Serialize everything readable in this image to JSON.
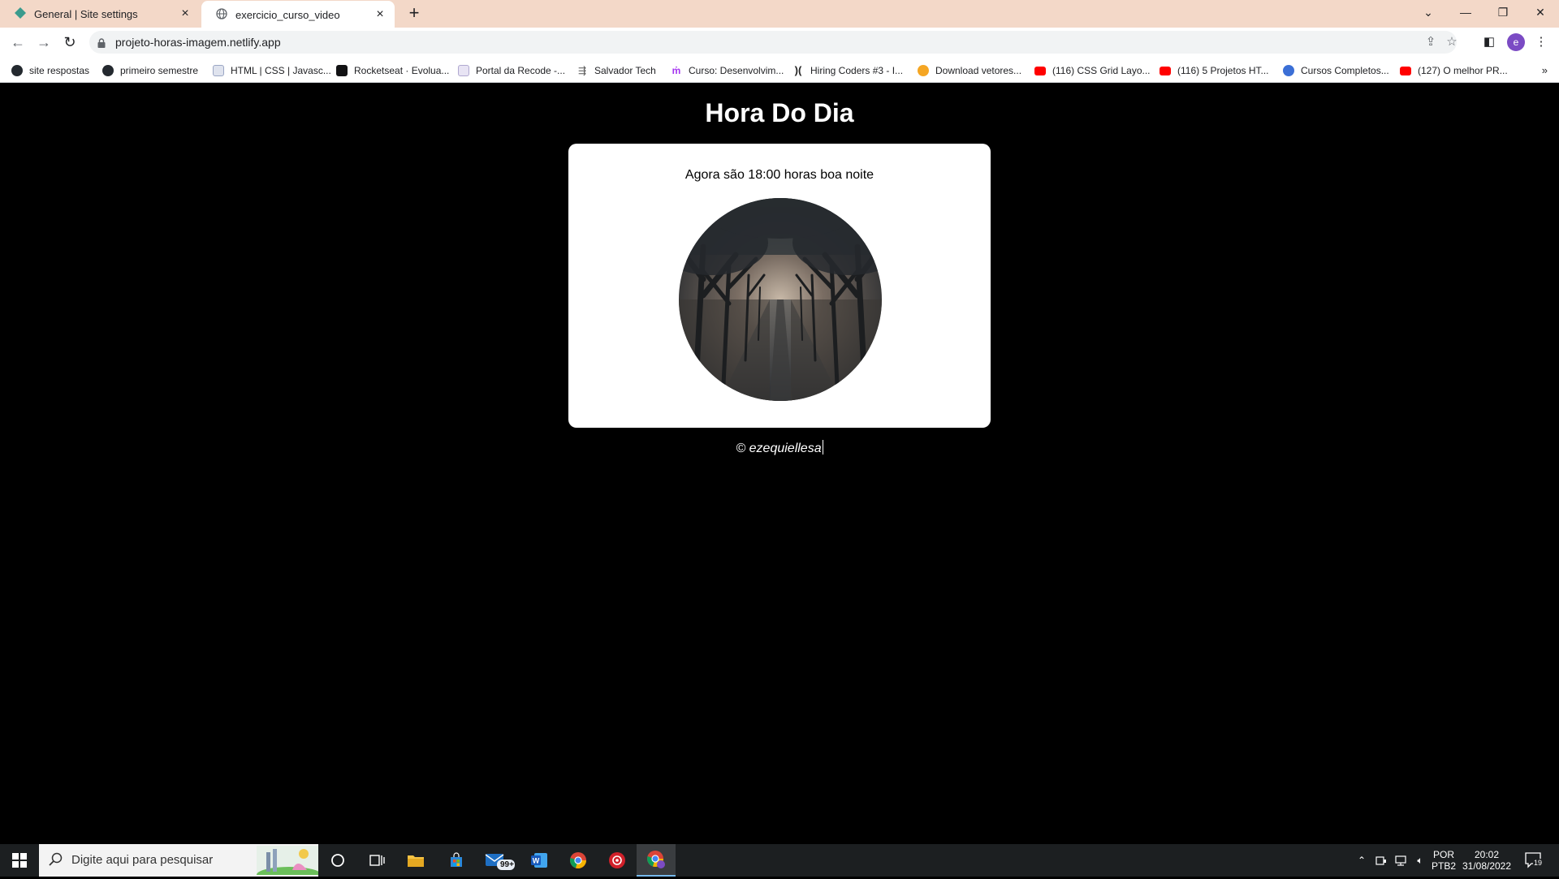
{
  "browser": {
    "tabs": [
      {
        "title": "General | Site settings",
        "close": "×"
      },
      {
        "title": "exercicio_curso_video",
        "close": "×"
      }
    ],
    "new_tab": "+",
    "window_controls": {
      "collapse": "⌄",
      "minimize": "—",
      "restore": "❐",
      "close": "✕"
    },
    "url": "projeto-horas-imagem.netlify.app",
    "avatar_letter": "e",
    "bookmarks": [
      {
        "label": "site respostas",
        "icon": "github-icon",
        "color": "#24292f"
      },
      {
        "label": "primeiro semestre",
        "icon": "github-icon",
        "color": "#24292f"
      },
      {
        "label": "HTML | CSS | Javasc...",
        "icon": "page-icon",
        "color": "#9aa6c4"
      },
      {
        "label": "Rocketseat · Evolua...",
        "icon": "rocketseat-icon",
        "color": "#121214"
      },
      {
        "label": "Portal da Recode -...",
        "icon": "page-icon",
        "color": "#b0a8d0"
      },
      {
        "label": "Salvador Tech",
        "icon": "arrow-icon",
        "color": "#555555"
      },
      {
        "label": "Curso: Desenvolvim...",
        "icon": "udemy-icon",
        "color": "#a435f0"
      },
      {
        "label": "Hiring Coders #3 - I...",
        "icon": "vtex-icon",
        "color": "#222222"
      },
      {
        "label": "Download vetores...",
        "icon": "freepik-icon",
        "color": "#f5a623"
      },
      {
        "label": "(116) CSS Grid Layo...",
        "icon": "youtube-icon",
        "color": "#ff0000"
      },
      {
        "label": "(116) 5 Projetos HT...",
        "icon": "youtube-icon",
        "color": "#ff0000"
      },
      {
        "label": "Cursos Completos...",
        "icon": "globe-icon",
        "color": "#3b6fd6"
      },
      {
        "label": "(127) O melhor PR...",
        "icon": "youtube-icon",
        "color": "#ff0000"
      }
    ],
    "bookmarks_more": "»"
  },
  "page": {
    "title": "Hora Do Dia",
    "message": "Agora são 18:00 horas boa noite",
    "footer": "© ezequiellesa"
  },
  "taskbar": {
    "search_placeholder": "Digite aqui para pesquisar",
    "mail_badge": "99+",
    "language": {
      "line1": "POR",
      "line2": "PTB2"
    },
    "clock": {
      "time": "20:02",
      "date": "31/08/2022"
    },
    "notifications": "19"
  }
}
